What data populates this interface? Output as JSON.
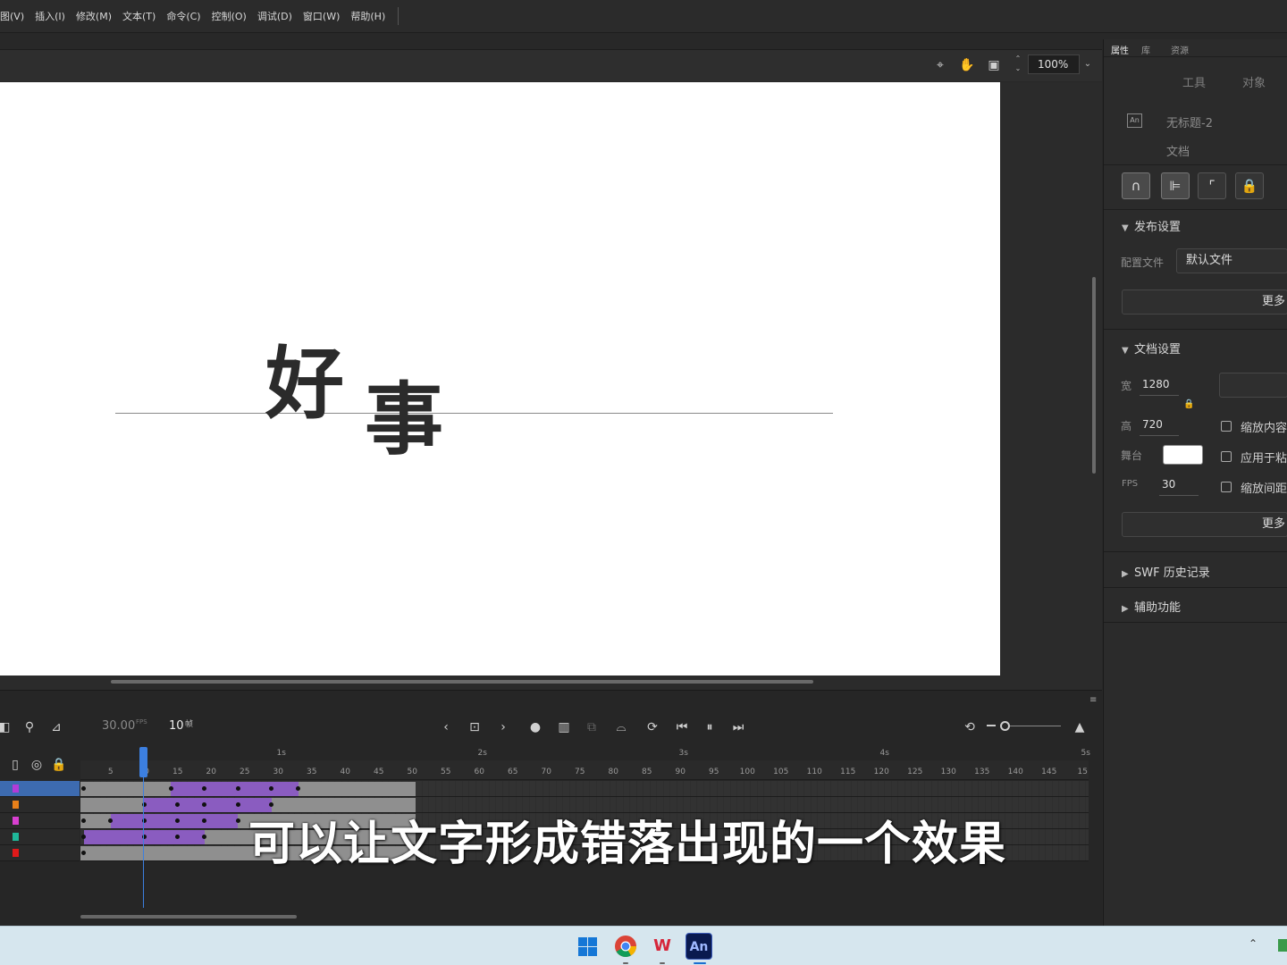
{
  "menubar": {
    "items": [
      "图(V)",
      "插入(I)",
      "修改(M)",
      "文本(T)",
      "命令(C)",
      "控制(O)",
      "调试(D)",
      "窗口(W)",
      "帮助(H)"
    ]
  },
  "stage_toolbar": {
    "zoom": "100%",
    "icons": [
      "center-stage-icon",
      "rotate-stage-icon",
      "clip-content-icon"
    ]
  },
  "stage": {
    "background": "#ffffff",
    "glyphs": [
      "好",
      "事"
    ]
  },
  "panel": {
    "tabs": [
      "属性",
      "库",
      "资源"
    ],
    "active_tab": "属性",
    "subtabs": [
      "工具",
      "对象"
    ],
    "doc_icon": "An",
    "doc_name": "无标题-2",
    "doc_type": "文档",
    "publish": {
      "heading": "发布设置",
      "profile_label": "配置文件",
      "profile_value": "默认文件",
      "more": "更多"
    },
    "document": {
      "heading": "文档设置",
      "width_label": "宽",
      "width": "1280",
      "height_label": "高",
      "height": "720",
      "stage_label": "舞台",
      "stage_color": "#ffffff",
      "fps_label": "FPS",
      "fps": "30",
      "checkboxes": [
        "缩放内容",
        "应用于粘",
        "缩放间距"
      ],
      "more": "更多"
    },
    "swf_history": "SWF 历史记录",
    "accessibility": "辅助功能"
  },
  "timeline": {
    "fps": "30.00",
    "fps_unit": "FPS",
    "current_frame": "10",
    "frame_unit": "帧",
    "playhead_frame": 10,
    "seconds": [
      "1s",
      "2s",
      "3s",
      "4s",
      "5s"
    ],
    "ticks": [
      "5",
      "10",
      "15",
      "20",
      "25",
      "30",
      "35",
      "40",
      "45",
      "50",
      "55",
      "60",
      "65",
      "70",
      "75",
      "80",
      "85",
      "90",
      "95",
      "100",
      "105",
      "110",
      "115",
      "120",
      "125",
      "130",
      "135",
      "140",
      "145",
      "15"
    ],
    "layer_colors": [
      "#b23bd8",
      "#e8801a",
      "#d83fd0",
      "#1fb89a",
      "#e01a1a"
    ],
    "layers": [
      {
        "gray": [
          [
            1,
            14
          ],
          [
            33,
            50
          ]
        ],
        "tween": [
          [
            14,
            33
          ]
        ],
        "keys": [
          1,
          14,
          19,
          24,
          29,
          33
        ]
      },
      {
        "gray": [
          [
            1,
            10
          ],
          [
            29,
            50
          ]
        ],
        "tween": [
          [
            10,
            29
          ]
        ],
        "keys": [
          10,
          15,
          19,
          24,
          29
        ]
      },
      {
        "gray": [
          [
            1,
            5
          ],
          [
            24,
            50
          ]
        ],
        "tween": [
          [
            5,
            24
          ]
        ],
        "keys": [
          1,
          5,
          10,
          15,
          19,
          24
        ]
      },
      {
        "gray": [
          [
            19,
            50
          ]
        ],
        "tween": [
          [
            1,
            19
          ]
        ],
        "keys": [
          1,
          10,
          15,
          19
        ]
      },
      {
        "gray": [
          [
            1,
            50
          ]
        ],
        "tween": [],
        "keys": [
          1
        ]
      }
    ]
  },
  "subtitle": "可以让文字形成错落出现的一个效果",
  "taskbar": {
    "an_label": "An"
  }
}
